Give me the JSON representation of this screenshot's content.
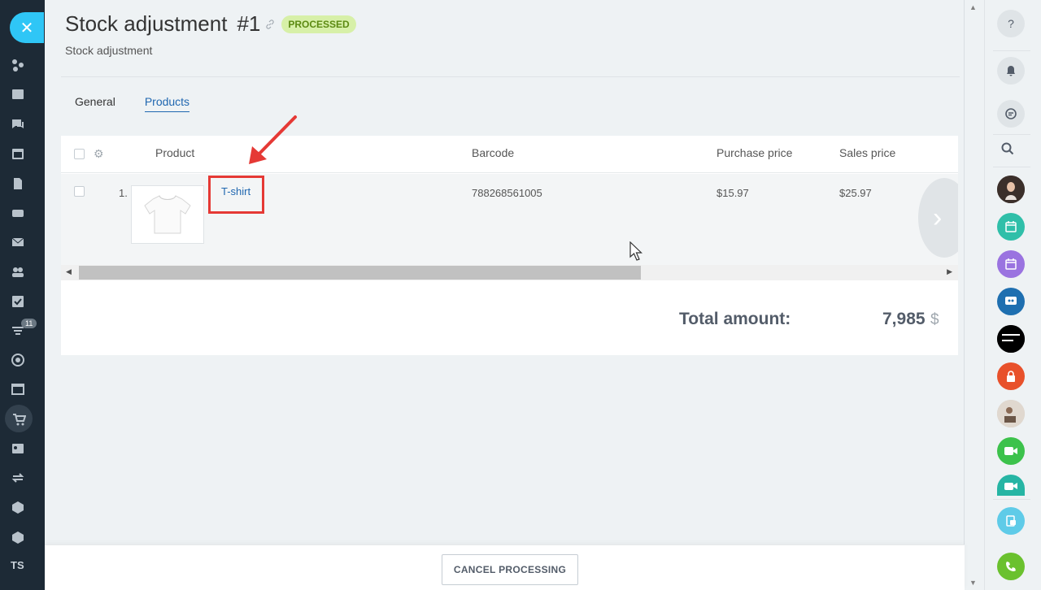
{
  "header": {
    "title": "Stock adjustment",
    "doc_number": "#1",
    "status": "PROCESSED",
    "subtitle": "Stock adjustment"
  },
  "tabs": [
    {
      "label": "General",
      "active": false
    },
    {
      "label": "Products",
      "active": true
    }
  ],
  "table": {
    "columns": [
      "Product",
      "Barcode",
      "Purchase price",
      "Sales price"
    ],
    "rows": [
      {
        "index": "1.",
        "product": "T-shirt",
        "barcode": "788268561005",
        "purchase_price": "$15.97",
        "sales_price": "$25.97"
      }
    ]
  },
  "totals": {
    "label": "Total amount:",
    "value": "7,985",
    "currency": "$"
  },
  "footer": {
    "cancel_label": "CANCEL PROCESSING"
  },
  "left_sidebar": {
    "counter_badge": "11",
    "user_initials": "TS"
  },
  "colors": {
    "accent": "#2fc6f6",
    "link": "#2067b0",
    "status_badge_bg": "#d7f0a8",
    "highlight": "#e53935"
  }
}
